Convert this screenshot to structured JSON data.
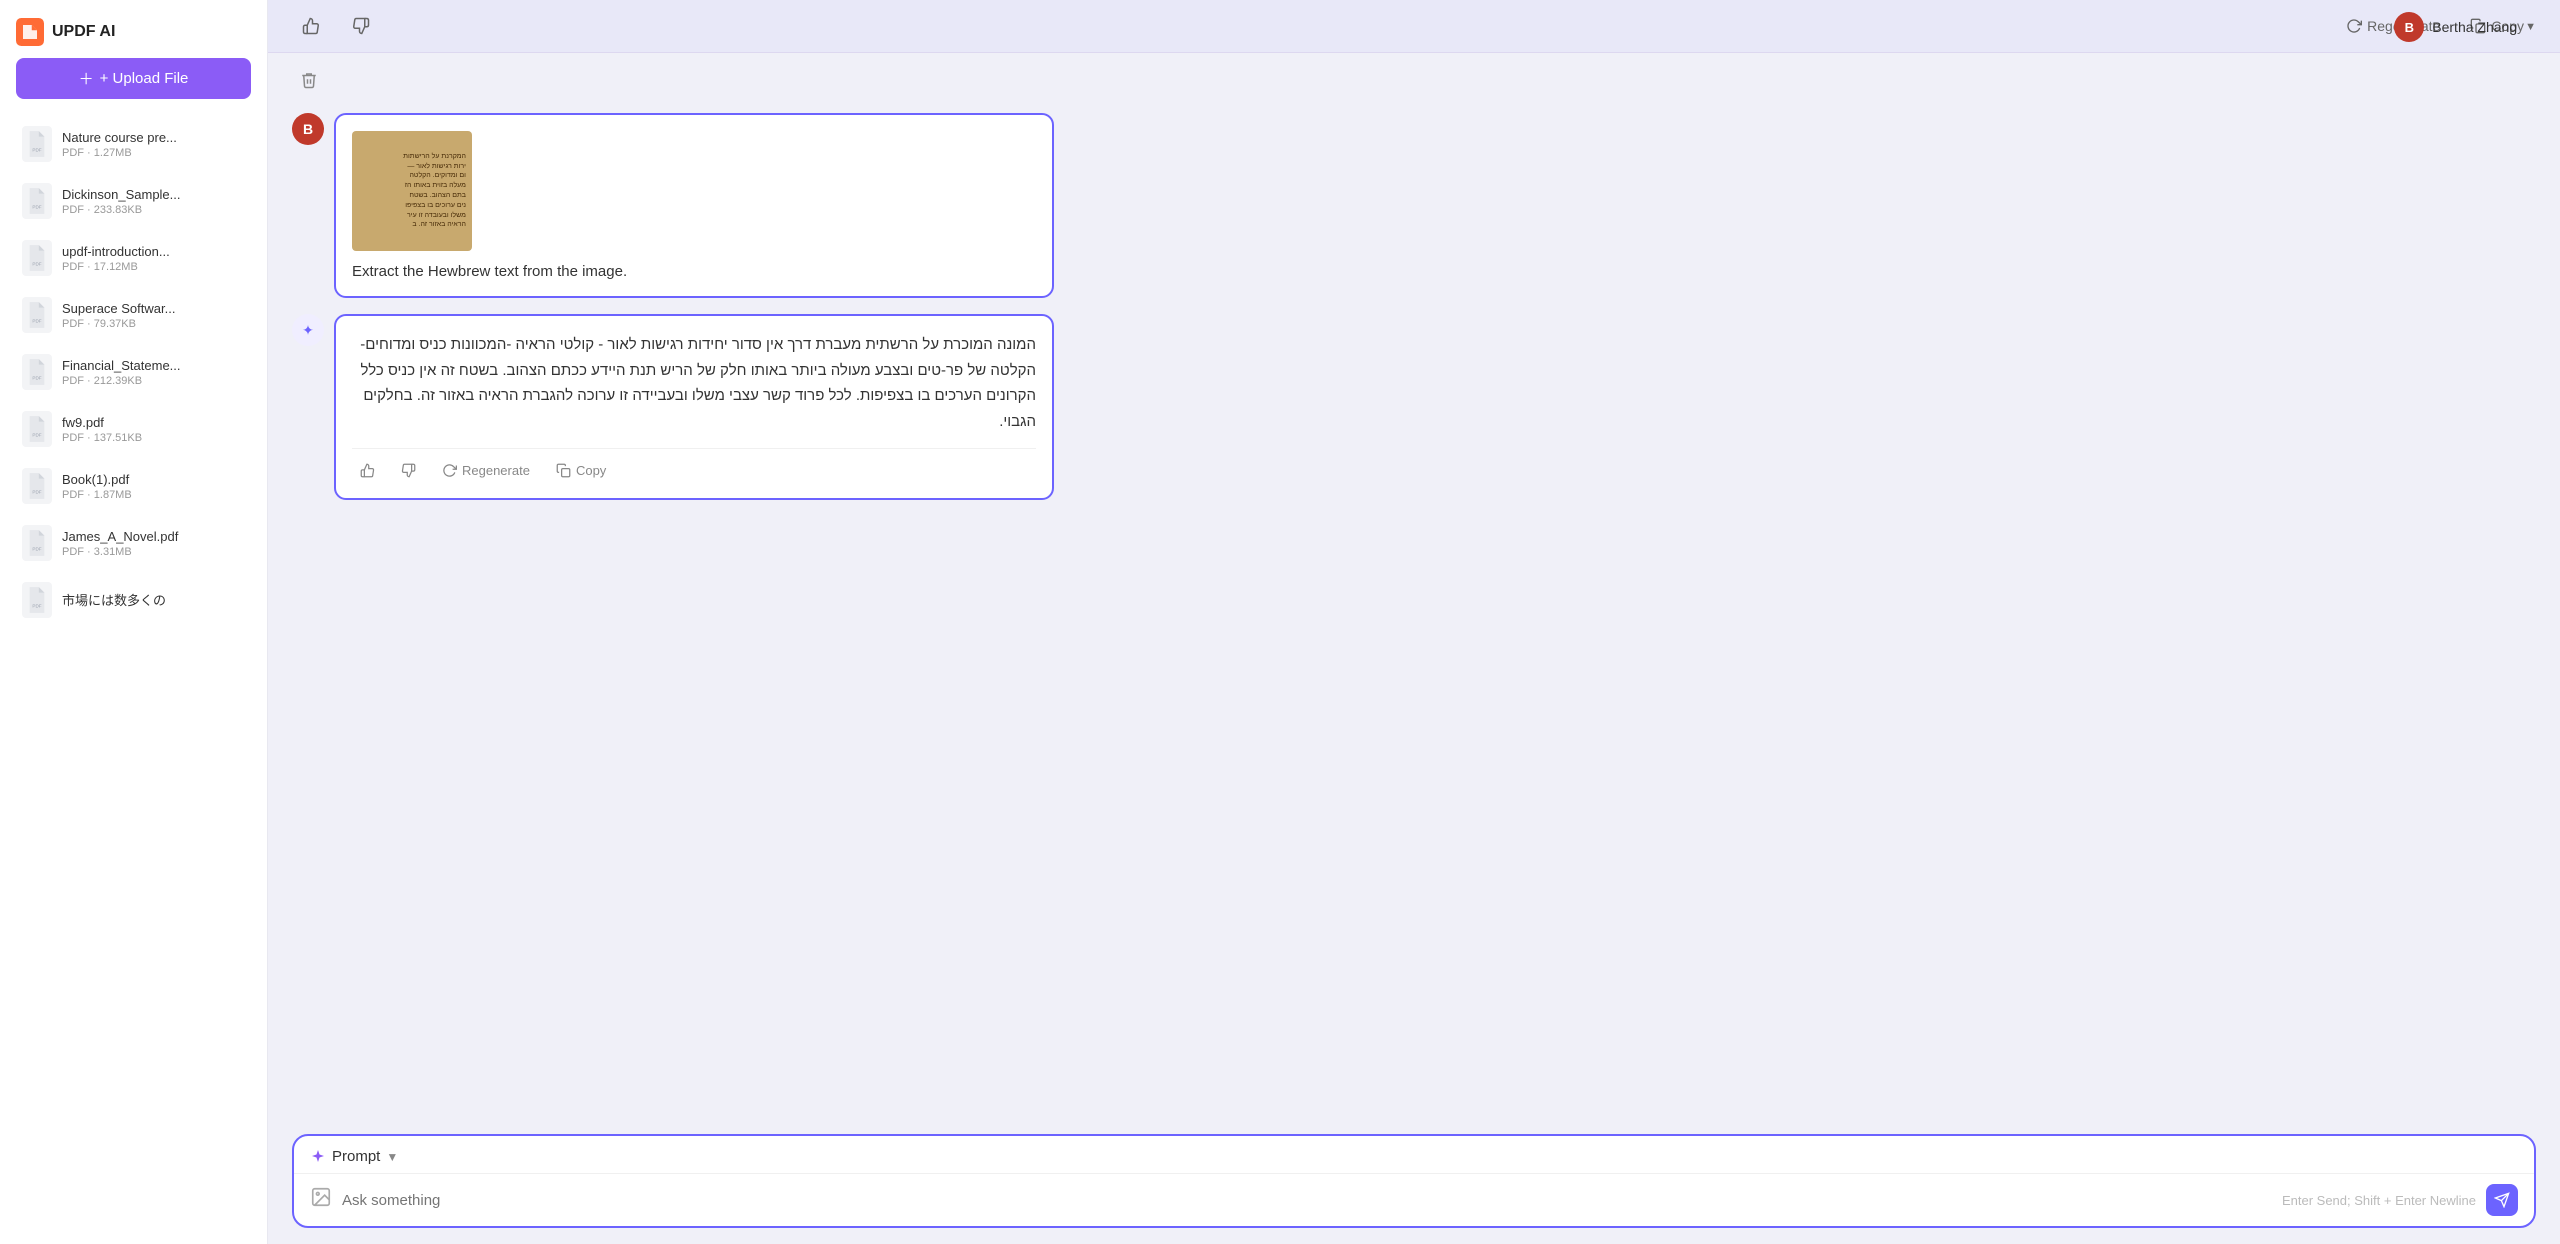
{
  "app": {
    "title": "UPDF AI",
    "user": {
      "name": "Bertha Zhang",
      "initial": "B"
    }
  },
  "sidebar": {
    "upload_label": "+ Upload File",
    "files": [
      {
        "name": "Nature course pre...",
        "size": "PDF · 1.27MB"
      },
      {
        "name": "Dickinson_Sample...",
        "size": "PDF · 233.83KB"
      },
      {
        "name": "updf-introduction...",
        "size": "PDF · 17.12MB"
      },
      {
        "name": "Superace Softwar...",
        "size": "PDF · 79.37KB"
      },
      {
        "name": "Financial_Stateme...",
        "size": "PDF · 212.39KB"
      },
      {
        "name": "fw9.pdf",
        "size": "PDF · 137.51KB"
      },
      {
        "name": "Book(1).pdf",
        "size": "PDF · 1.87MB"
      },
      {
        "name": "James_A_Novel.pdf",
        "size": "PDF · 3.31MB"
      },
      {
        "name": "市場には数多くの",
        "size": ""
      }
    ]
  },
  "toolbar": {
    "regenerate_label": "Regenerate",
    "copy_label": "Copy"
  },
  "chat": {
    "user_initial": "B",
    "ai_initial": "✦",
    "user_message": {
      "prompt": "Extract the Hewbrew text from the image.",
      "hebrew_sample": "המקרנת על הרישתות\nירות רגישות לאור —\nום ומדוקים. הקלטה\nמעלה בזוית באותו הז\nבתם הצהוב. בשטח\nנים ערוכים בו בצפיפו\nמשלו ובעובדה זו עיר\nהראיה באזור זה. ב"
    },
    "ai_response": {
      "text": "המונה המוכרת על הרשתית מעברת דרך אין סדור יחידות רגישות לאור - קולטי הראיה -המכוונות כניס ומדוחים- הקלטה של פר-טים ובצבע מעולה ביותר באותו חלק של הריש תנת היידע ככתם הצהוב. בשטח זה אין כניס כלל הקרונים הערכים בו בצפיפות. לכל פרוד קשר עצבי משלו ובעביידה זו ערוכה להגברת הראיה באזור זה. בחלקים הגבוי."
    },
    "actions": {
      "regenerate": "Regenerate",
      "copy": "Copy"
    }
  },
  "prompt_area": {
    "label": "Prompt",
    "placeholder": "Ask something",
    "hint": "Enter Send; Shift + Enter Newline"
  }
}
